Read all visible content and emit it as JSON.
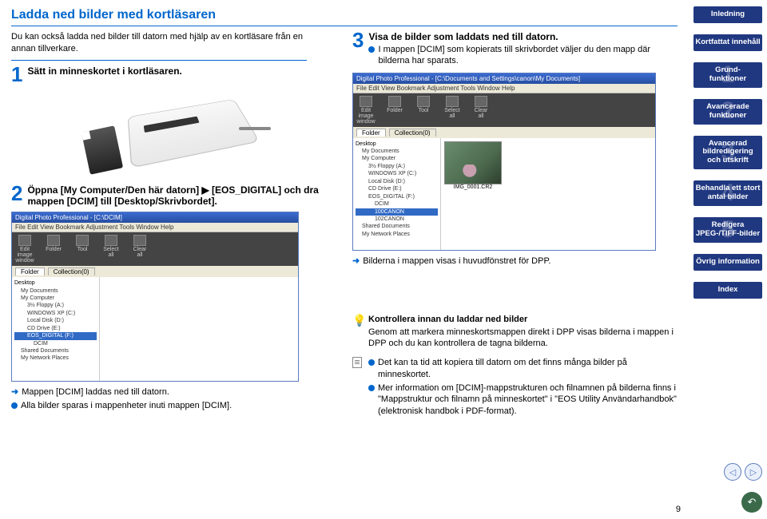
{
  "title": "Ladda ned bilder med kortläsaren",
  "intro": "Du kan också ladda ned bilder till datorn med hjälp av en kortläsare från en annan tillverkare.",
  "steps": {
    "s1": {
      "num": "1",
      "title": "Sätt in minneskortet i kortläsaren."
    },
    "s2": {
      "num": "2",
      "title": "Öppna [My Computer/Den här datorn] ▶ [EOS_DIGITAL] och dra mappen [DCIM] till [Desktop/Skrivbordet]."
    },
    "s3": {
      "num": "3",
      "title": "Visa de bilder som laddats ned till datorn.",
      "bullet": "I mappen [DCIM] som kopierats till skrivbordet väljer du den mapp där bilderna har sparats."
    }
  },
  "screenshot": {
    "title": "Digital Photo Professional - [C:\\DCIM]",
    "title2": "Digital Photo Professional - [C:\\Documents and Settings\\canon\\My Documents]",
    "menu": "File  Edit  View  Bookmark  Adjustment  Tools  Window  Help",
    "toolbar": [
      "Edit image window",
      "Folder",
      "Tool",
      "Select all",
      "Clear all"
    ],
    "tabs": [
      "Folder",
      "Collection(0)"
    ],
    "tree": {
      "root": "Desktop",
      "items": [
        "My Documents",
        "My Computer",
        "3½ Floppy (A:)",
        "WINDOWS XP (C:)",
        "Local Disk (D:)",
        "CD Drive (E:)",
        "EOS_DIGITAL (F:)",
        "DCIM",
        "Shared Documents",
        "My Network Places"
      ],
      "sub": [
        "100CANON",
        "102CANON"
      ]
    },
    "thumbname": "IMG_0001.CR2",
    "status": ""
  },
  "captions": {
    "a1": "Mappen [DCIM] laddas ned till datorn.",
    "b1": "Alla bilder sparas i mappenheter inuti mappen [DCIM].",
    "a2": "Bilderna i mappen visas i huvudfönstret för DPP."
  },
  "tip1": {
    "title": "Kontrollera innan du laddar ned bilder",
    "text": "Genom att markera minneskortsmappen direkt i DPP visas bilderna i mappen i DPP och du kan kontrollera de tagna bilderna."
  },
  "tip2": {
    "b1": "Det kan ta tid att kopiera till datorn om det finns många bilder på minneskortet.",
    "b2": "Mer information om [DCIM]-mappstrukturen och filnamnen på bilderna finns i \"Mappstruktur och filnamn på minneskortet\" i \"EOS Utility Användarhandbok\" (elektronisk handbok i PDF-format)."
  },
  "sidebar": {
    "items": [
      {
        "label": "Inledning"
      },
      {
        "label": "Kortfattat innehåll"
      },
      {
        "label": "Grund-\nfunktioner",
        "num": "1"
      },
      {
        "label": "Avancerade funktioner",
        "num": "2"
      },
      {
        "label": "Avancerad bildredigering och utskrift",
        "num": "3"
      },
      {
        "label": "Behandla ett stort antal bilder",
        "num": "4"
      },
      {
        "label": "Redigera JPEG-/TIFF-bilder",
        "num": "5"
      },
      {
        "label": "Övrig information"
      },
      {
        "label": "Index"
      }
    ]
  },
  "pageNumber": "9"
}
